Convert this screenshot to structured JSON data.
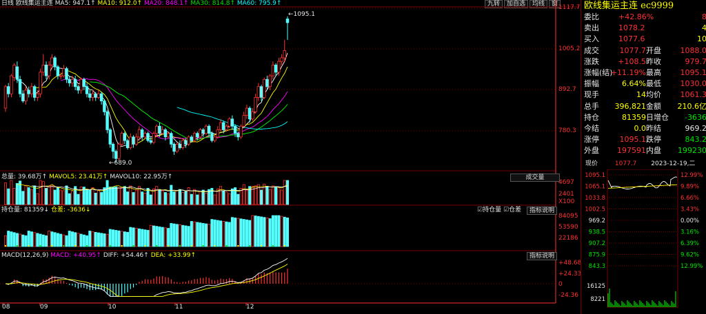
{
  "colors": {
    "up": "#ff3232",
    "down": "#54ffff",
    "ma5": "#ffffff",
    "ma10": "#ffff00",
    "ma20": "#ff00ff",
    "ma30": "#00ff00",
    "ma60": "#00ffff",
    "grid": "#7a0000",
    "axis": "#ff3232"
  },
  "header": {
    "period": "日线",
    "name": "欧线集运主连",
    "ma": [
      {
        "label": "MA5: 947.1↑"
      },
      {
        "label": "MA10: 912.0↑"
      },
      {
        "label": "MA20: 848.1↑"
      },
      {
        "label": "MA30: 814.8↑"
      },
      {
        "label": "MA60: 795.9↑"
      }
    ],
    "buttons": [
      "九转",
      "加自选",
      "均线",
      "窗"
    ]
  },
  "price_axis": [
    "1117.7",
    "1005.2",
    "892.7",
    "780.3"
  ],
  "price_annotations": {
    "high": "1095.1",
    "low": "689.0"
  },
  "vol_panel": {
    "label_total": "总量: 39.68万↑",
    "label_ma5": "MAVOL5: 23.41万↑",
    "label_ma10": "MAVOL10: 22.95万↑",
    "button": "成交量",
    "axis": [
      "4697",
      "2401",
      "X100"
    ]
  },
  "oi_panel": {
    "label_oi": "持仓量: 81359↓",
    "label_diff": "仓差: -3636↓",
    "check1": "持仓量",
    "check2": "仓差",
    "button": "指标说明",
    "axis": [
      "84095",
      "53590",
      "22186"
    ]
  },
  "macd_panel": {
    "label_title": "MACD(12,26,9)",
    "label_macd": "MACD: +40.95↑",
    "label_diff": "DIFF: +54.46↑",
    "label_dea": "DEA: +33.99↑",
    "button": "指标说明",
    "axis": [
      "+48.68",
      "+24.33",
      "0",
      "-24.36"
    ]
  },
  "date_axis": [
    "08",
    "09",
    "10",
    "11",
    "12"
  ],
  "quote": {
    "title": "欧线集运主连 ec9999",
    "rows": [
      {
        "l1": "委比",
        "v1": "+42.86%",
        "c1": "red",
        "v2": "8",
        "c2": "red"
      },
      {
        "l1": "卖出",
        "v1": "1078.2",
        "c1": "red",
        "v2": "4",
        "c2": "yel"
      },
      {
        "l1": "买入",
        "v1": "1077.6",
        "c1": "red",
        "v2": "10",
        "c2": "yel"
      },
      {
        "l1": "成交",
        "v1": "1077.7",
        "c1": "red",
        "l2": "开盘",
        "v2": "1088.0",
        "c2": "red"
      },
      {
        "l1": "涨跌",
        "v1": "+108.5",
        "c1": "red",
        "l2": "昨收",
        "v2": "979.7",
        "c2": "red"
      },
      {
        "l1": "涨幅(结)",
        "v1": "+11.19%",
        "c1": "red",
        "l2": "最高",
        "v2": "1095.1",
        "c2": "red"
      },
      {
        "l1": "振幅",
        "v1": "6.64%",
        "c1": "yel",
        "l2": "最低",
        "v2": "1030.0",
        "c2": "red"
      },
      {
        "l1": "现手",
        "v1": "14",
        "c1": "yel",
        "l2": "均价",
        "v2": "1061.3",
        "c2": "red"
      },
      {
        "l1": "总手",
        "v1": "396,821",
        "c1": "yel",
        "l2": "金额",
        "v2": "210.6亿",
        "c2": "yel"
      },
      {
        "l1": "持仓",
        "v1": "81359",
        "c1": "yel",
        "l2": "日增仓",
        "v2": "-3636",
        "c2": "grn"
      },
      {
        "l1": "今结",
        "v1": "0.0",
        "c1": "yel",
        "l2": "昨结",
        "v2": "969.2",
        "c2": "wht"
      },
      {
        "l1": "涨停",
        "v1": "1095.1",
        "c1": "red",
        "l2": "跌停",
        "v2": "843.2",
        "c2": "grn"
      },
      {
        "l1": "外盘",
        "v1": "197591",
        "c1": "red",
        "l2": "内盘",
        "v2": "199230",
        "c2": "grn"
      }
    ]
  },
  "mini": {
    "label": "现价",
    "price": "1077.7",
    "date": "2023-12-19,二",
    "left_axis": [
      "1095.1",
      "1065.1",
      "1033.8",
      "1002.5",
      "969.2",
      "938.5",
      "907.2",
      "875.9",
      "843.3"
    ],
    "right_axis": [
      "12.99%",
      "9.89%",
      "6.66%",
      "3.43%",
      "0.00%",
      "3.16%",
      "6.39%",
      "9.62%",
      "12.99%"
    ],
    "vol_axis": [
      "16125",
      "8221"
    ]
  },
  "chart_data": {
    "type": "candlestick",
    "title": "欧线集运主连 日线",
    "ylim": [
      689.0,
      1117.7
    ],
    "high_marker": 1095.1,
    "low_marker": 689.0,
    "candles": [
      [
        840,
        900,
        830,
        905
      ],
      [
        900,
        880,
        870,
        910
      ],
      [
        880,
        930,
        870,
        935
      ],
      [
        925,
        960,
        915,
        965
      ],
      [
        955,
        920,
        910,
        970
      ],
      [
        920,
        880,
        870,
        930
      ],
      [
        880,
        860,
        855,
        890
      ],
      [
        860,
        890,
        850,
        900
      ],
      [
        890,
        880,
        870,
        900
      ],
      [
        880,
        900,
        870,
        910
      ],
      [
        900,
        870,
        860,
        905
      ],
      [
        870,
        880,
        860,
        890
      ],
      [
        880,
        940,
        870,
        950
      ],
      [
        940,
        960,
        930,
        990
      ],
      [
        960,
        930,
        920,
        970
      ],
      [
        930,
        960,
        920,
        970
      ],
      [
        960,
        980,
        950,
        990
      ],
      [
        980,
        955,
        945,
        985
      ],
      [
        955,
        930,
        920,
        960
      ],
      [
        930,
        930,
        920,
        940
      ],
      [
        930,
        950,
        925,
        960
      ],
      [
        950,
        920,
        910,
        955
      ],
      [
        920,
        910,
        900,
        930
      ],
      [
        910,
        920,
        900,
        930
      ],
      [
        920,
        900,
        890,
        930
      ],
      [
        900,
        890,
        880,
        905
      ],
      [
        890,
        920,
        880,
        925
      ],
      [
        920,
        900,
        890,
        925
      ],
      [
        900,
        880,
        870,
        910
      ],
      [
        880,
        870,
        860,
        890
      ],
      [
        870,
        880,
        860,
        890
      ],
      [
        880,
        870,
        860,
        885
      ],
      [
        870,
        880,
        865,
        890
      ],
      [
        880,
        860,
        850,
        885
      ],
      [
        860,
        830,
        820,
        865
      ],
      [
        830,
        780,
        770,
        835
      ],
      [
        780,
        740,
        730,
        785
      ],
      [
        740,
        720,
        700,
        745
      ],
      [
        720,
        700,
        689,
        725
      ],
      [
        700,
        740,
        695,
        745
      ],
      [
        740,
        770,
        735,
        775
      ],
      [
        770,
        750,
        740,
        775
      ],
      [
        750,
        730,
        725,
        755
      ],
      [
        730,
        760,
        725,
        770
      ],
      [
        760,
        740,
        730,
        765
      ],
      [
        740,
        760,
        735,
        770
      ],
      [
        760,
        780,
        750,
        790
      ],
      [
        780,
        760,
        750,
        785
      ],
      [
        760,
        770,
        755,
        775
      ],
      [
        770,
        750,
        745,
        775
      ],
      [
        750,
        745,
        740,
        760
      ],
      [
        745,
        770,
        740,
        775
      ],
      [
        770,
        790,
        760,
        795
      ],
      [
        790,
        770,
        760,
        800
      ],
      [
        770,
        780,
        765,
        790
      ],
      [
        780,
        760,
        750,
        785
      ],
      [
        760,
        770,
        755,
        775
      ],
      [
        770,
        740,
        730,
        775
      ],
      [
        740,
        720,
        710,
        745
      ],
      [
        720,
        740,
        715,
        745
      ],
      [
        740,
        730,
        725,
        750
      ],
      [
        730,
        750,
        725,
        755
      ],
      [
        750,
        740,
        730,
        755
      ],
      [
        740,
        760,
        735,
        765
      ],
      [
        760,
        750,
        745,
        765
      ],
      [
        750,
        770,
        745,
        775
      ],
      [
        770,
        760,
        750,
        775
      ],
      [
        760,
        780,
        755,
        785
      ],
      [
        780,
        770,
        760,
        785
      ],
      [
        770,
        790,
        765,
        795
      ],
      [
        790,
        770,
        760,
        795
      ],
      [
        770,
        750,
        745,
        775
      ],
      [
        750,
        760,
        745,
        765
      ],
      [
        760,
        780,
        755,
        790
      ],
      [
        780,
        800,
        775,
        810
      ],
      [
        800,
        780,
        770,
        805
      ],
      [
        780,
        790,
        775,
        795
      ],
      [
        790,
        810,
        785,
        815
      ],
      [
        810,
        790,
        780,
        820
      ],
      [
        790,
        770,
        760,
        795
      ],
      [
        770,
        760,
        750,
        775
      ],
      [
        760,
        790,
        755,
        795
      ],
      [
        790,
        820,
        785,
        830
      ],
      [
        820,
        840,
        810,
        850
      ],
      [
        840,
        810,
        800,
        845
      ],
      [
        810,
        830,
        805,
        840
      ],
      [
        830,
        870,
        825,
        880
      ],
      [
        870,
        900,
        860,
        910
      ],
      [
        900,
        870,
        860,
        905
      ],
      [
        870,
        920,
        865,
        925
      ],
      [
        920,
        900,
        890,
        930
      ],
      [
        900,
        930,
        890,
        935
      ],
      [
        930,
        960,
        920,
        970
      ],
      [
        960,
        940,
        930,
        965
      ],
      [
        940,
        970,
        930,
        980
      ],
      [
        970,
        980,
        960,
        990
      ],
      [
        980,
        1000,
        970,
        1030
      ],
      [
        1088,
        1077.7,
        1030,
        1095.1
      ]
    ],
    "volume_axis": [
      2401,
      4697
    ],
    "oi_axis": [
      22186,
      53590,
      84095
    ],
    "macd_axis": [
      -24.36,
      0,
      24.33,
      48.68
    ],
    "macd": {
      "macd": 40.95,
      "diff": 54.46,
      "dea": 33.99
    }
  }
}
